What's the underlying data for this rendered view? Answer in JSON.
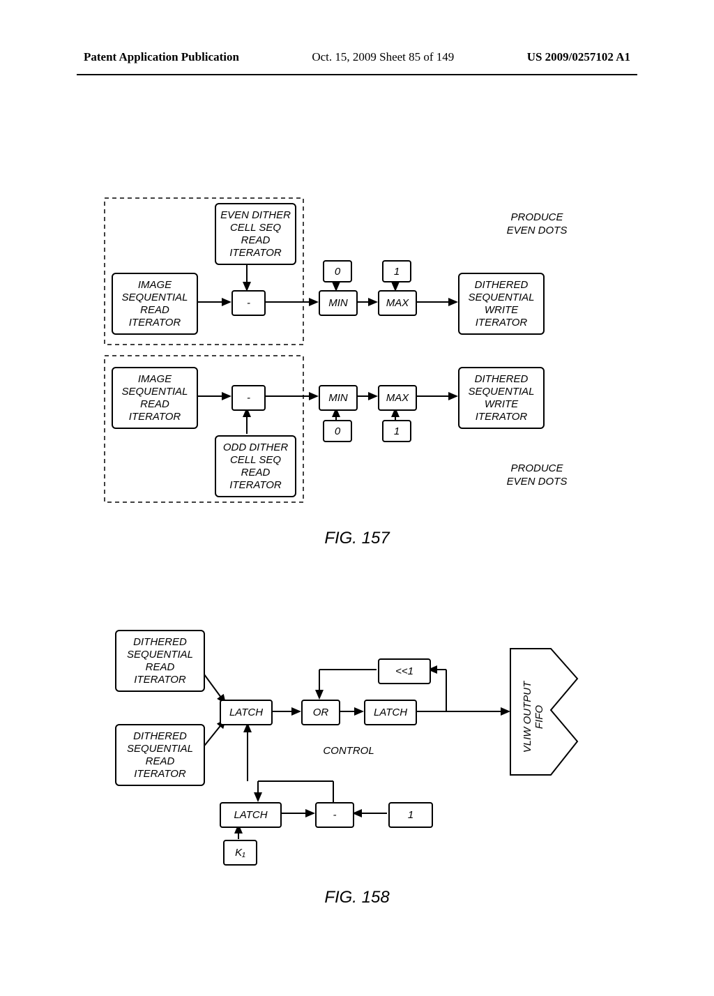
{
  "header": {
    "left": "Patent Application Publication",
    "center": "Oct. 15, 2009   Sheet 85 of 149",
    "right": "US 2009/0257102 A1"
  },
  "fig157": {
    "image_iterator": "IMAGE\nSEQUENTIAL\nREAD\nITERATOR",
    "even_dither": "EVEN DITHER\nCELL SEQ\nREAD\nITERATOR",
    "odd_dither": "ODD DITHER\nCELL SEQ\nREAD\nITERATOR",
    "dithered_write": "DITHERED\nSEQUENTIAL\nWRITE\nITERATOR",
    "sub": "-",
    "min": "MIN",
    "max": "MAX",
    "zero": "0",
    "one": "1",
    "produce_even": "PRODUCE\nEVEN DOTS",
    "caption": "FIG. 157"
  },
  "fig158": {
    "dithered_read": "DITHERED\nSEQUENTIAL\nREAD\nITERATOR",
    "latch": "LATCH",
    "or": "OR",
    "shift": "<<1",
    "control": "CONTROL",
    "sub": "-",
    "one": "1",
    "k1": "K₁",
    "fifo": "VLIW OUTPUT\nFIFO",
    "caption": "FIG. 158"
  }
}
